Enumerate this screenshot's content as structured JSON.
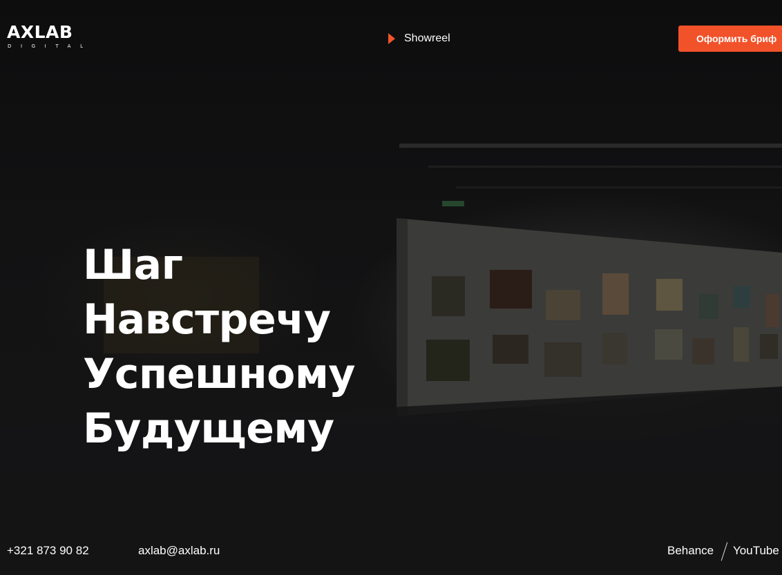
{
  "header": {
    "logo": {
      "title": "AXLAB",
      "subtitle": "DIGITAL"
    },
    "showreel": {
      "label": "Showreel",
      "icon": "play-icon",
      "icon_color": "#f0542b"
    },
    "brief_button": {
      "label": "Оформить бриф",
      "color": "#f2522a"
    }
  },
  "hero": {
    "lines": [
      "Шаг",
      "Навстречу",
      "Успешному",
      "Будущему"
    ]
  },
  "footer": {
    "phone": "+321 873 90 82",
    "email": "axlab@axlab.ru",
    "social": [
      "Behance",
      "YouTube"
    ]
  }
}
